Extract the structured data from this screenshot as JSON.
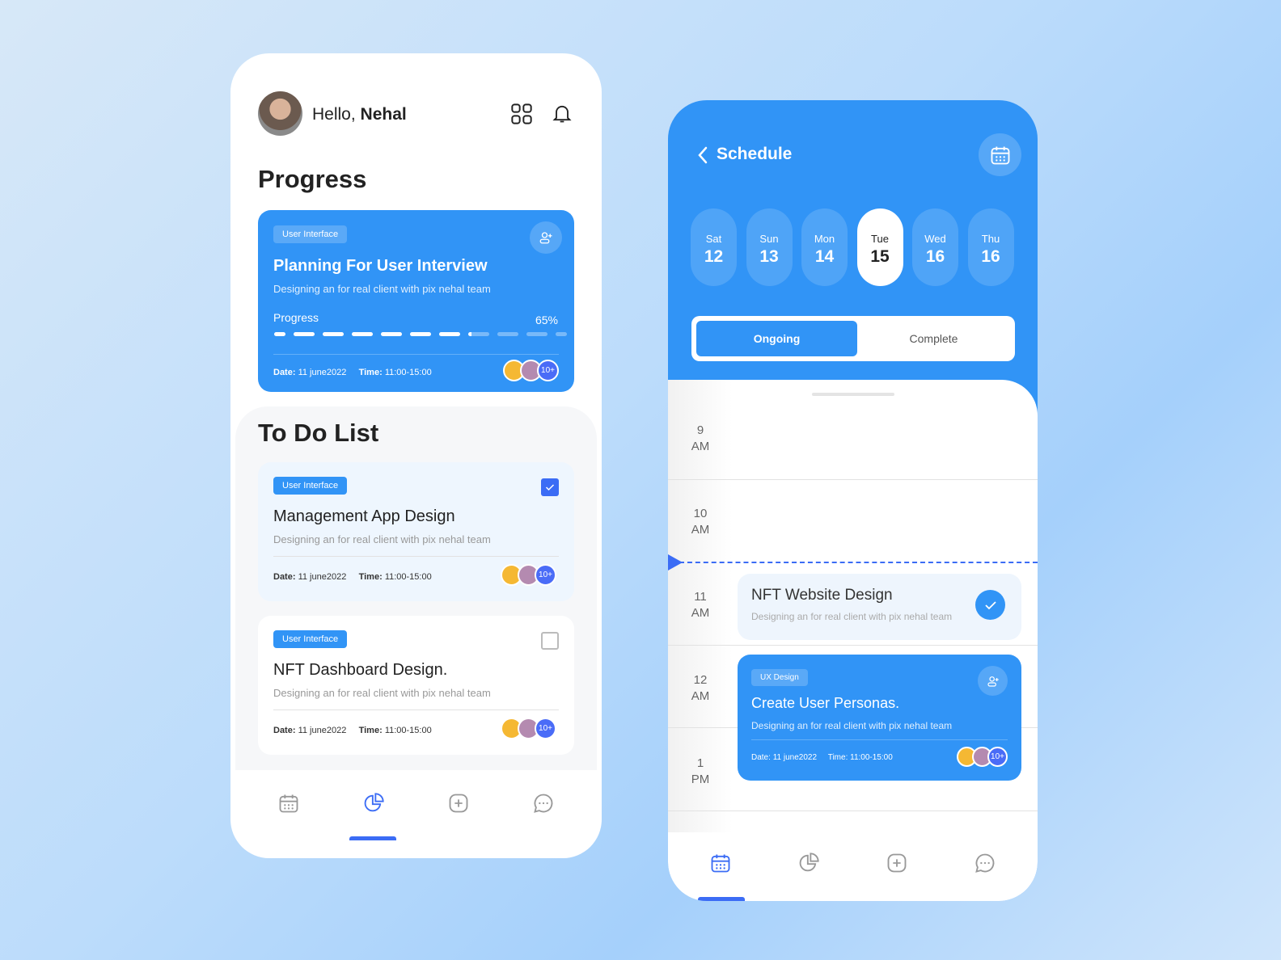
{
  "left": {
    "greeting": "Hello,",
    "user_name": "Nehal",
    "progress_heading": "Progress",
    "progress_card": {
      "tag": "User Interface",
      "title": "Planning For User Interview",
      "subtitle": "Designing an for real client with  pix nehal team",
      "progress_label": "Progress",
      "progress_value": "65%",
      "progress_percent": 65,
      "date_label": "Date:",
      "date": "11 june2022",
      "time_label": "Time:",
      "time": "11:00-15:00",
      "more": "10+"
    },
    "todo_heading": "To Do List",
    "todos": [
      {
        "tag": "User Interface",
        "title": "Management App Design",
        "subtitle": "Designing an for real client with  pix nehal team",
        "date_label": "Date:",
        "date": "11 june2022",
        "time_label": "Time:",
        "time": "11:00-15:00",
        "more": "10+",
        "checked": true
      },
      {
        "tag": "User Interface",
        "title": "NFT Dashboard Design.",
        "subtitle": "Designing an for real client with  pix nehal team",
        "date_label": "Date:",
        "date": "11 june2022",
        "time_label": "Time:",
        "time": "11:00-15:00",
        "more": "10+",
        "checked": false
      }
    ],
    "nav_active": "stats"
  },
  "right": {
    "title": "Schedule",
    "days": [
      {
        "name": "Sat",
        "num": "12"
      },
      {
        "name": "Sun",
        "num": "13"
      },
      {
        "name": "Mon",
        "num": "14"
      },
      {
        "name": "Tue",
        "num": "15",
        "active": true
      },
      {
        "name": "Wed",
        "num": "16"
      },
      {
        "name": "Thu",
        "num": "16"
      }
    ],
    "tabs": {
      "ongoing": "Ongoing",
      "complete": "Complete",
      "active": "Ongoing"
    },
    "times": [
      {
        "h": "9",
        "p": "AM"
      },
      {
        "h": "10",
        "p": "AM"
      },
      {
        "h": "11",
        "p": "AM"
      },
      {
        "h": "12",
        "p": "AM"
      },
      {
        "h": "1",
        "p": "PM"
      }
    ],
    "event1": {
      "title": "NFT Website Design",
      "subtitle": "Designing an for real client with  pix nehal team"
    },
    "event2": {
      "tag": "UX Design",
      "title": "Create User Personas.",
      "subtitle": "Designing an for real client with  pix nehal team",
      "date_label": "Date:",
      "date": "11 june2022",
      "time_label": "Time:",
      "time": "11:00-15:00",
      "more": "10+"
    },
    "nav_active": "calendar"
  },
  "colors": {
    "accent": "#3194f6",
    "indigo": "#4a6cf7"
  }
}
